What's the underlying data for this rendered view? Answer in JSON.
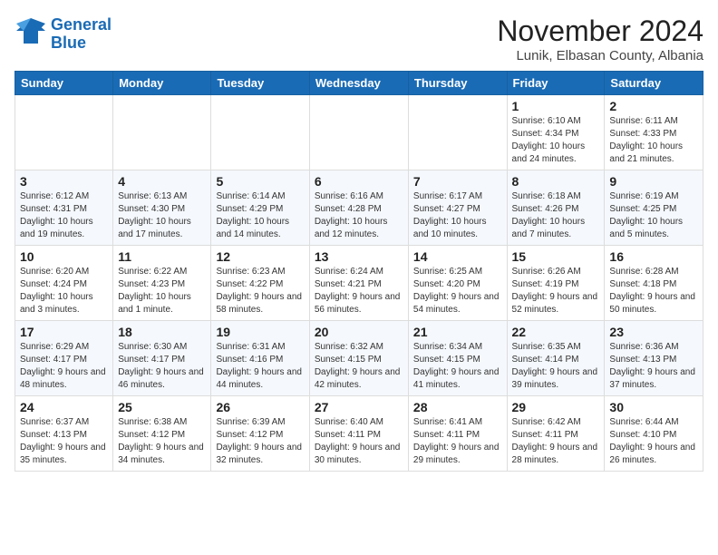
{
  "header": {
    "logo_line1": "General",
    "logo_line2": "Blue",
    "month_year": "November 2024",
    "location": "Lunik, Elbasan County, Albania"
  },
  "days_of_week": [
    "Sunday",
    "Monday",
    "Tuesday",
    "Wednesday",
    "Thursday",
    "Friday",
    "Saturday"
  ],
  "weeks": [
    [
      {
        "day": "",
        "info": ""
      },
      {
        "day": "",
        "info": ""
      },
      {
        "day": "",
        "info": ""
      },
      {
        "day": "",
        "info": ""
      },
      {
        "day": "",
        "info": ""
      },
      {
        "day": "1",
        "info": "Sunrise: 6:10 AM\nSunset: 4:34 PM\nDaylight: 10 hours and 24 minutes."
      },
      {
        "day": "2",
        "info": "Sunrise: 6:11 AM\nSunset: 4:33 PM\nDaylight: 10 hours and 21 minutes."
      }
    ],
    [
      {
        "day": "3",
        "info": "Sunrise: 6:12 AM\nSunset: 4:31 PM\nDaylight: 10 hours and 19 minutes."
      },
      {
        "day": "4",
        "info": "Sunrise: 6:13 AM\nSunset: 4:30 PM\nDaylight: 10 hours and 17 minutes."
      },
      {
        "day": "5",
        "info": "Sunrise: 6:14 AM\nSunset: 4:29 PM\nDaylight: 10 hours and 14 minutes."
      },
      {
        "day": "6",
        "info": "Sunrise: 6:16 AM\nSunset: 4:28 PM\nDaylight: 10 hours and 12 minutes."
      },
      {
        "day": "7",
        "info": "Sunrise: 6:17 AM\nSunset: 4:27 PM\nDaylight: 10 hours and 10 minutes."
      },
      {
        "day": "8",
        "info": "Sunrise: 6:18 AM\nSunset: 4:26 PM\nDaylight: 10 hours and 7 minutes."
      },
      {
        "day": "9",
        "info": "Sunrise: 6:19 AM\nSunset: 4:25 PM\nDaylight: 10 hours and 5 minutes."
      }
    ],
    [
      {
        "day": "10",
        "info": "Sunrise: 6:20 AM\nSunset: 4:24 PM\nDaylight: 10 hours and 3 minutes."
      },
      {
        "day": "11",
        "info": "Sunrise: 6:22 AM\nSunset: 4:23 PM\nDaylight: 10 hours and 1 minute."
      },
      {
        "day": "12",
        "info": "Sunrise: 6:23 AM\nSunset: 4:22 PM\nDaylight: 9 hours and 58 minutes."
      },
      {
        "day": "13",
        "info": "Sunrise: 6:24 AM\nSunset: 4:21 PM\nDaylight: 9 hours and 56 minutes."
      },
      {
        "day": "14",
        "info": "Sunrise: 6:25 AM\nSunset: 4:20 PM\nDaylight: 9 hours and 54 minutes."
      },
      {
        "day": "15",
        "info": "Sunrise: 6:26 AM\nSunset: 4:19 PM\nDaylight: 9 hours and 52 minutes."
      },
      {
        "day": "16",
        "info": "Sunrise: 6:28 AM\nSunset: 4:18 PM\nDaylight: 9 hours and 50 minutes."
      }
    ],
    [
      {
        "day": "17",
        "info": "Sunrise: 6:29 AM\nSunset: 4:17 PM\nDaylight: 9 hours and 48 minutes."
      },
      {
        "day": "18",
        "info": "Sunrise: 6:30 AM\nSunset: 4:17 PM\nDaylight: 9 hours and 46 minutes."
      },
      {
        "day": "19",
        "info": "Sunrise: 6:31 AM\nSunset: 4:16 PM\nDaylight: 9 hours and 44 minutes."
      },
      {
        "day": "20",
        "info": "Sunrise: 6:32 AM\nSunset: 4:15 PM\nDaylight: 9 hours and 42 minutes."
      },
      {
        "day": "21",
        "info": "Sunrise: 6:34 AM\nSunset: 4:15 PM\nDaylight: 9 hours and 41 minutes."
      },
      {
        "day": "22",
        "info": "Sunrise: 6:35 AM\nSunset: 4:14 PM\nDaylight: 9 hours and 39 minutes."
      },
      {
        "day": "23",
        "info": "Sunrise: 6:36 AM\nSunset: 4:13 PM\nDaylight: 9 hours and 37 minutes."
      }
    ],
    [
      {
        "day": "24",
        "info": "Sunrise: 6:37 AM\nSunset: 4:13 PM\nDaylight: 9 hours and 35 minutes."
      },
      {
        "day": "25",
        "info": "Sunrise: 6:38 AM\nSunset: 4:12 PM\nDaylight: 9 hours and 34 minutes."
      },
      {
        "day": "26",
        "info": "Sunrise: 6:39 AM\nSunset: 4:12 PM\nDaylight: 9 hours and 32 minutes."
      },
      {
        "day": "27",
        "info": "Sunrise: 6:40 AM\nSunset: 4:11 PM\nDaylight: 9 hours and 30 minutes."
      },
      {
        "day": "28",
        "info": "Sunrise: 6:41 AM\nSunset: 4:11 PM\nDaylight: 9 hours and 29 minutes."
      },
      {
        "day": "29",
        "info": "Sunrise: 6:42 AM\nSunset: 4:11 PM\nDaylight: 9 hours and 28 minutes."
      },
      {
        "day": "30",
        "info": "Sunrise: 6:44 AM\nSunset: 4:10 PM\nDaylight: 9 hours and 26 minutes."
      }
    ]
  ]
}
